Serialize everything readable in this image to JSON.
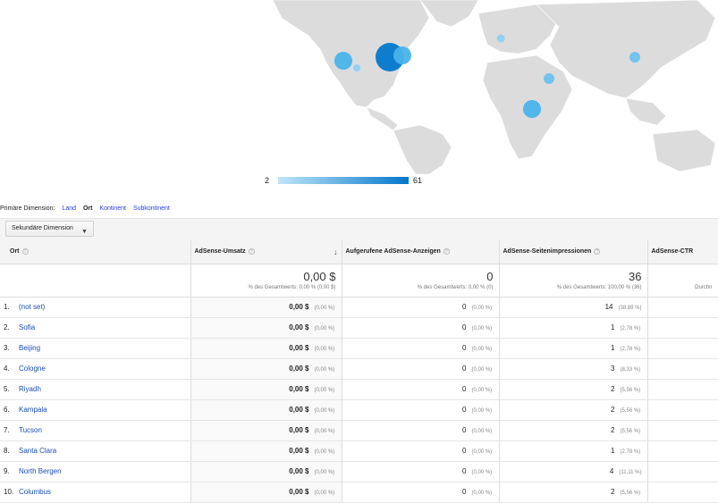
{
  "map": {
    "land_color": "#dcdcdc",
    "border_color": "#ffffff",
    "bubbles": [
      {
        "region": "North Carolina",
        "intensity": 1.0
      },
      {
        "region": "New York",
        "intensity": 0.5
      },
      {
        "region": "California",
        "intensity": 0.4
      },
      {
        "region": "Arizona",
        "intensity": 0.25
      },
      {
        "region": "Germany",
        "intensity": 0.3
      },
      {
        "region": "Saudi Arabia",
        "intensity": 0.35
      },
      {
        "region": "Uganda",
        "intensity": 0.45
      },
      {
        "region": "China",
        "intensity": 0.3
      }
    ],
    "legend": {
      "min": "2",
      "max": "61",
      "color_low": "#bfe6f8",
      "color_high": "#0277cc"
    }
  },
  "dimensions": {
    "label": "Primäre Dimension:",
    "options": [
      {
        "label": "Land",
        "active": false
      },
      {
        "label": "Ort",
        "active": true
      },
      {
        "label": "Kontinent",
        "active": false
      },
      {
        "label": "Subkontinent",
        "active": false
      }
    ]
  },
  "toolbar": {
    "secondary_dimension": "Sekundäre Dimension"
  },
  "table": {
    "columns": [
      {
        "label": "Ort"
      },
      {
        "label": "AdSense-Umsatz"
      },
      {
        "label": "Aufgerufene AdSense-Anzeigen"
      },
      {
        "label": "AdSense-Seitenimpressionen"
      },
      {
        "label": "AdSense-CTR"
      }
    ],
    "totals": [
      {
        "big": "0,00 $",
        "sub": "% des Gesamtwerts: 0,00 % (0,00 $)"
      },
      {
        "big": "0",
        "sub": "% des Gesamtwerts: 0,00 % (0)"
      },
      {
        "big": "36",
        "sub": "% des Gesamtwerts: 100,00 % (36)"
      },
      {
        "big": "",
        "sub": "Durchn"
      }
    ],
    "rows": [
      {
        "num": "1.",
        "name": "(not set)",
        "rev": "0,00 $",
        "rev_pct": "(0,00 %)",
        "ads": "0",
        "ads_pct": "(0,00 %)",
        "imp": "14",
        "imp_pct": "(38,89 %)"
      },
      {
        "num": "2.",
        "name": "Sofia",
        "rev": "0,00 $",
        "rev_pct": "(0,00 %)",
        "ads": "0",
        "ads_pct": "(0,00 %)",
        "imp": "1",
        "imp_pct": "(2,78 %)"
      },
      {
        "num": "3.",
        "name": "Beijing",
        "rev": "0,00 $",
        "rev_pct": "(0,00 %)",
        "ads": "0",
        "ads_pct": "(0,00 %)",
        "imp": "1",
        "imp_pct": "(2,78 %)"
      },
      {
        "num": "4.",
        "name": "Cologne",
        "rev": "0,00 $",
        "rev_pct": "(0,00 %)",
        "ads": "0",
        "ads_pct": "(0,00 %)",
        "imp": "3",
        "imp_pct": "(8,33 %)"
      },
      {
        "num": "5.",
        "name": "Riyadh",
        "rev": "0,00 $",
        "rev_pct": "(0,00 %)",
        "ads": "0",
        "ads_pct": "(0,00 %)",
        "imp": "2",
        "imp_pct": "(5,56 %)"
      },
      {
        "num": "6.",
        "name": "Kampala",
        "rev": "0,00 $",
        "rev_pct": "(0,00 %)",
        "ads": "0",
        "ads_pct": "(0,00 %)",
        "imp": "2",
        "imp_pct": "(5,56 %)"
      },
      {
        "num": "7.",
        "name": "Tucson",
        "rev": "0,00 $",
        "rev_pct": "(0,00 %)",
        "ads": "0",
        "ads_pct": "(0,00 %)",
        "imp": "2",
        "imp_pct": "(5,56 %)"
      },
      {
        "num": "8.",
        "name": "Santa Clara",
        "rev": "0,00 $",
        "rev_pct": "(0,00 %)",
        "ads": "0",
        "ads_pct": "(0,00 %)",
        "imp": "1",
        "imp_pct": "(2,78 %)"
      },
      {
        "num": "9.",
        "name": "North Bergen",
        "rev": "0,00 $",
        "rev_pct": "(0,00 %)",
        "ads": "0",
        "ads_pct": "(0,00 %)",
        "imp": "4",
        "imp_pct": "(11,11 %)"
      },
      {
        "num": "10.",
        "name": "Columbus",
        "rev": "0,00 $",
        "rev_pct": "(0,00 %)",
        "ads": "0",
        "ads_pct": "(0,00 %)",
        "imp": "2",
        "imp_pct": "(5,56 %)"
      }
    ]
  }
}
